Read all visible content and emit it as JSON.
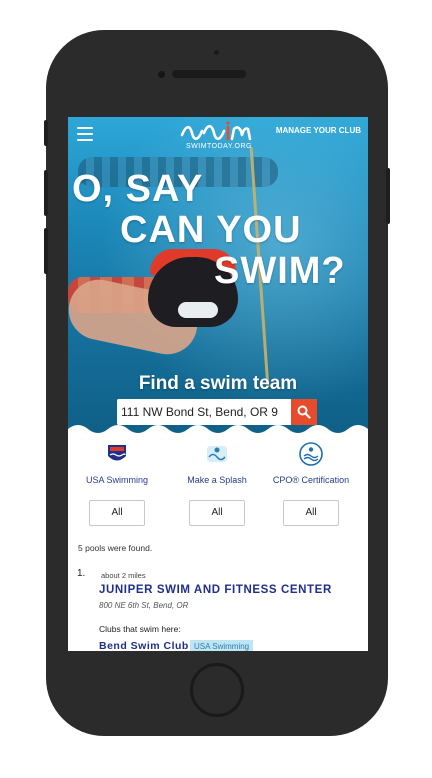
{
  "header": {
    "logo_text": "swim",
    "logo_url": "SWIMTODAY.ORG",
    "manage_label": "MANAGE YOUR CLUB"
  },
  "hero": {
    "line1": "O, SAY",
    "line2": "CAN YOU",
    "line3": "SWIM?",
    "find_title": "Find a swim team"
  },
  "search": {
    "value": "111 NW Bond St, Bend, OR 9"
  },
  "filters": [
    {
      "label": "USA Swimming",
      "value": "All",
      "icon": "usa-swimming-logo-icon"
    },
    {
      "label": "Make a Splash",
      "value": "All",
      "icon": "make-a-splash-logo-icon"
    },
    {
      "label": "CPO® Certification",
      "value": "All",
      "icon": "cpo-certification-logo-icon"
    }
  ],
  "results": {
    "count_text": "5 pools were found.",
    "items": [
      {
        "number": "1.",
        "distance": "about 2 miles",
        "name": "JUNIPER SWIM AND FITNESS CENTER",
        "address": "800 NE 6th St, Bend, OR",
        "clubs_label": "Clubs that swim here:",
        "club_name": "Bend Swim Club",
        "club_badge": "USA Swimming"
      }
    ]
  },
  "colors": {
    "brand_blue": "#1f2f8a",
    "accent_red": "#e84a2c",
    "hero_blue": "#1b87b8",
    "badge_bg": "#bfe4f3"
  }
}
